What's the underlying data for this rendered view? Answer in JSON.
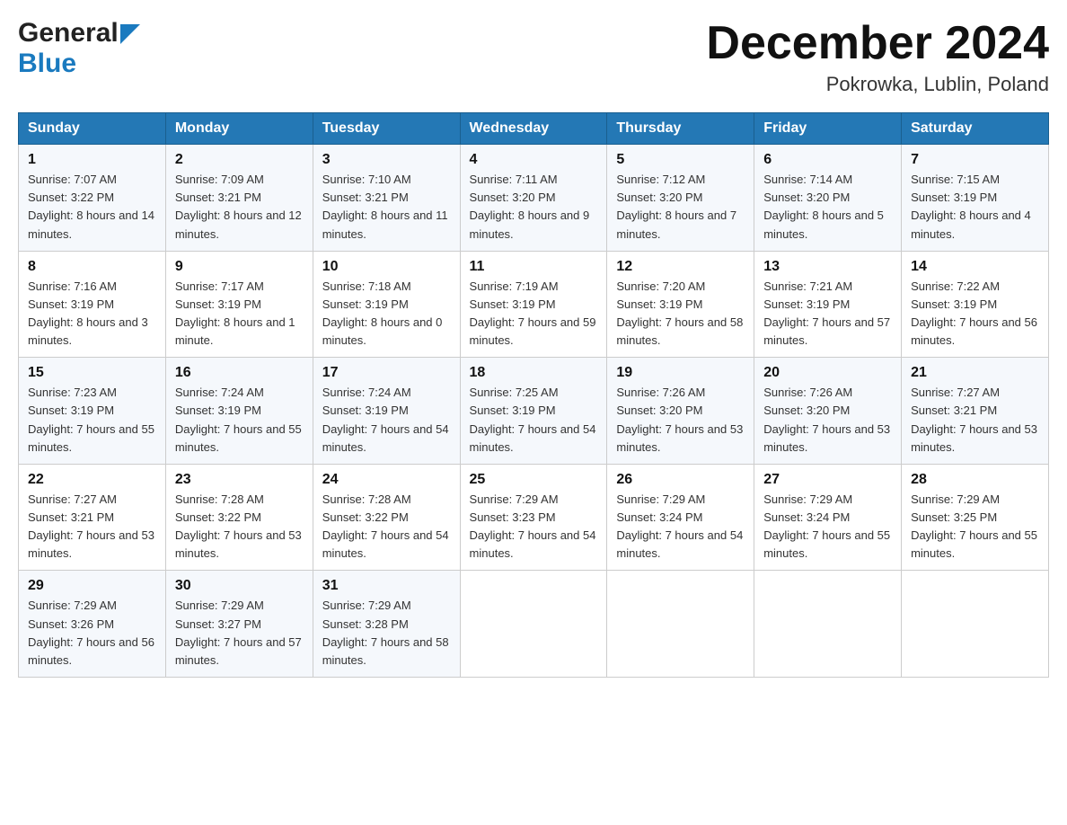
{
  "header": {
    "logo_general": "General",
    "logo_blue": "Blue",
    "month_title": "December 2024",
    "location": "Pokrowka, Lublin, Poland"
  },
  "days_of_week": [
    "Sunday",
    "Monday",
    "Tuesday",
    "Wednesday",
    "Thursday",
    "Friday",
    "Saturday"
  ],
  "weeks": [
    [
      {
        "day": "1",
        "sunrise": "7:07 AM",
        "sunset": "3:22 PM",
        "daylight": "8 hours and 14 minutes."
      },
      {
        "day": "2",
        "sunrise": "7:09 AM",
        "sunset": "3:21 PM",
        "daylight": "8 hours and 12 minutes."
      },
      {
        "day": "3",
        "sunrise": "7:10 AM",
        "sunset": "3:21 PM",
        "daylight": "8 hours and 11 minutes."
      },
      {
        "day": "4",
        "sunrise": "7:11 AM",
        "sunset": "3:20 PM",
        "daylight": "8 hours and 9 minutes."
      },
      {
        "day": "5",
        "sunrise": "7:12 AM",
        "sunset": "3:20 PM",
        "daylight": "8 hours and 7 minutes."
      },
      {
        "day": "6",
        "sunrise": "7:14 AM",
        "sunset": "3:20 PM",
        "daylight": "8 hours and 5 minutes."
      },
      {
        "day": "7",
        "sunrise": "7:15 AM",
        "sunset": "3:19 PM",
        "daylight": "8 hours and 4 minutes."
      }
    ],
    [
      {
        "day": "8",
        "sunrise": "7:16 AM",
        "sunset": "3:19 PM",
        "daylight": "8 hours and 3 minutes."
      },
      {
        "day": "9",
        "sunrise": "7:17 AM",
        "sunset": "3:19 PM",
        "daylight": "8 hours and 1 minute."
      },
      {
        "day": "10",
        "sunrise": "7:18 AM",
        "sunset": "3:19 PM",
        "daylight": "8 hours and 0 minutes."
      },
      {
        "day": "11",
        "sunrise": "7:19 AM",
        "sunset": "3:19 PM",
        "daylight": "7 hours and 59 minutes."
      },
      {
        "day": "12",
        "sunrise": "7:20 AM",
        "sunset": "3:19 PM",
        "daylight": "7 hours and 58 minutes."
      },
      {
        "day": "13",
        "sunrise": "7:21 AM",
        "sunset": "3:19 PM",
        "daylight": "7 hours and 57 minutes."
      },
      {
        "day": "14",
        "sunrise": "7:22 AM",
        "sunset": "3:19 PM",
        "daylight": "7 hours and 56 minutes."
      }
    ],
    [
      {
        "day": "15",
        "sunrise": "7:23 AM",
        "sunset": "3:19 PM",
        "daylight": "7 hours and 55 minutes."
      },
      {
        "day": "16",
        "sunrise": "7:24 AM",
        "sunset": "3:19 PM",
        "daylight": "7 hours and 55 minutes."
      },
      {
        "day": "17",
        "sunrise": "7:24 AM",
        "sunset": "3:19 PM",
        "daylight": "7 hours and 54 minutes."
      },
      {
        "day": "18",
        "sunrise": "7:25 AM",
        "sunset": "3:19 PM",
        "daylight": "7 hours and 54 minutes."
      },
      {
        "day": "19",
        "sunrise": "7:26 AM",
        "sunset": "3:20 PM",
        "daylight": "7 hours and 53 minutes."
      },
      {
        "day": "20",
        "sunrise": "7:26 AM",
        "sunset": "3:20 PM",
        "daylight": "7 hours and 53 minutes."
      },
      {
        "day": "21",
        "sunrise": "7:27 AM",
        "sunset": "3:21 PM",
        "daylight": "7 hours and 53 minutes."
      }
    ],
    [
      {
        "day": "22",
        "sunrise": "7:27 AM",
        "sunset": "3:21 PM",
        "daylight": "7 hours and 53 minutes."
      },
      {
        "day": "23",
        "sunrise": "7:28 AM",
        "sunset": "3:22 PM",
        "daylight": "7 hours and 53 minutes."
      },
      {
        "day": "24",
        "sunrise": "7:28 AM",
        "sunset": "3:22 PM",
        "daylight": "7 hours and 54 minutes."
      },
      {
        "day": "25",
        "sunrise": "7:29 AM",
        "sunset": "3:23 PM",
        "daylight": "7 hours and 54 minutes."
      },
      {
        "day": "26",
        "sunrise": "7:29 AM",
        "sunset": "3:24 PM",
        "daylight": "7 hours and 54 minutes."
      },
      {
        "day": "27",
        "sunrise": "7:29 AM",
        "sunset": "3:24 PM",
        "daylight": "7 hours and 55 minutes."
      },
      {
        "day": "28",
        "sunrise": "7:29 AM",
        "sunset": "3:25 PM",
        "daylight": "7 hours and 55 minutes."
      }
    ],
    [
      {
        "day": "29",
        "sunrise": "7:29 AM",
        "sunset": "3:26 PM",
        "daylight": "7 hours and 56 minutes."
      },
      {
        "day": "30",
        "sunrise": "7:29 AM",
        "sunset": "3:27 PM",
        "daylight": "7 hours and 57 minutes."
      },
      {
        "day": "31",
        "sunrise": "7:29 AM",
        "sunset": "3:28 PM",
        "daylight": "7 hours and 58 minutes."
      },
      null,
      null,
      null,
      null
    ]
  ],
  "labels": {
    "sunrise": "Sunrise:",
    "sunset": "Sunset:",
    "daylight": "Daylight:"
  }
}
